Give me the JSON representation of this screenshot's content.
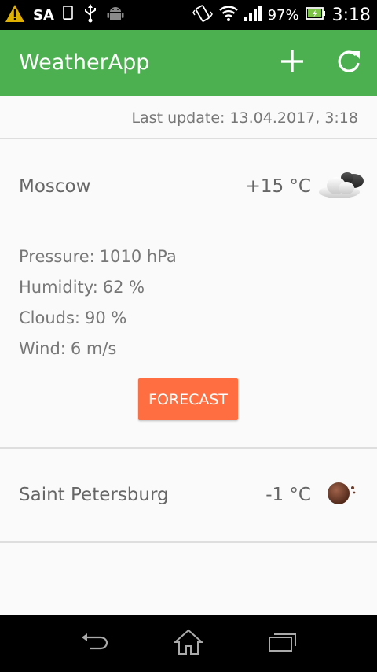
{
  "status_bar": {
    "carrier": "SA",
    "battery": "97%",
    "time": "3:18",
    "icons": [
      "warning-icon",
      "sim-icon",
      "usb-icon",
      "android-icon",
      "vibrate-icon",
      "wifi-icon",
      "signal-icon",
      "battery-icon"
    ]
  },
  "app_bar": {
    "title": "WeatherApp",
    "icons": [
      "add-icon",
      "refresh-icon"
    ]
  },
  "last_update": "Last update: 13.04.2017, 3:18",
  "cities": [
    {
      "name": "Moscow",
      "temp": "+15 °C",
      "weather_icon": "cloudy-night-icon",
      "details": [
        {
          "label": "Pressure:",
          "value": "1010 hPa"
        },
        {
          "label": "Humidity:",
          "value": "62 %"
        },
        {
          "label": "Clouds:",
          "value": "90 %"
        },
        {
          "label": "Wind:",
          "value": "6 m/s"
        }
      ],
      "forecast_button": "FORECAST"
    },
    {
      "name": "Saint Petersburg",
      "temp": "-1 °C",
      "weather_icon": "clear-night-icon"
    }
  ],
  "colors": {
    "app_bar": "#4caf50",
    "accent": "#ff6e40"
  },
  "nav_bar": {
    "icons": [
      "back-icon",
      "home-icon",
      "recents-icon"
    ]
  }
}
